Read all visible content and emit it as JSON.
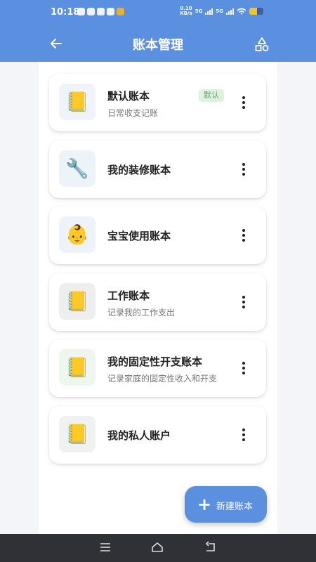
{
  "status": {
    "time": "10:18",
    "net_speed": "0.10\nKB/s",
    "sig1": "5G",
    "sig2": "5G"
  },
  "header": {
    "title": "账本管理",
    "back": "back-arrow-icon",
    "right": "shapes-icon"
  },
  "books": [
    {
      "name": "默认账本",
      "desc": "日常收支记账",
      "badge": "默认",
      "icon": "📒",
      "bg": "#f0f3f9"
    },
    {
      "name": "我的装修账本",
      "desc": "",
      "badge": "",
      "icon": "🔧",
      "bg": "#eef3fa"
    },
    {
      "name": "宝宝使用账本",
      "desc": "",
      "badge": "",
      "icon": "👶",
      "bg": "#eef3fa"
    },
    {
      "name": "工作账本",
      "desc": "记录我的工作支出",
      "badge": "",
      "icon": "📒",
      "bg": "#eeeeee"
    },
    {
      "name": "我的固定性开支账本",
      "desc": "记录家庭的固定性收入和开支",
      "badge": "",
      "icon": "📒",
      "bg": "#eef7ef"
    },
    {
      "name": "我的私人账户",
      "desc": "",
      "badge": "",
      "icon": "📒",
      "bg": "#f0f1f1"
    }
  ],
  "fab": {
    "label": "新建账本"
  },
  "colors": {
    "primary": "#5b8fdf"
  }
}
